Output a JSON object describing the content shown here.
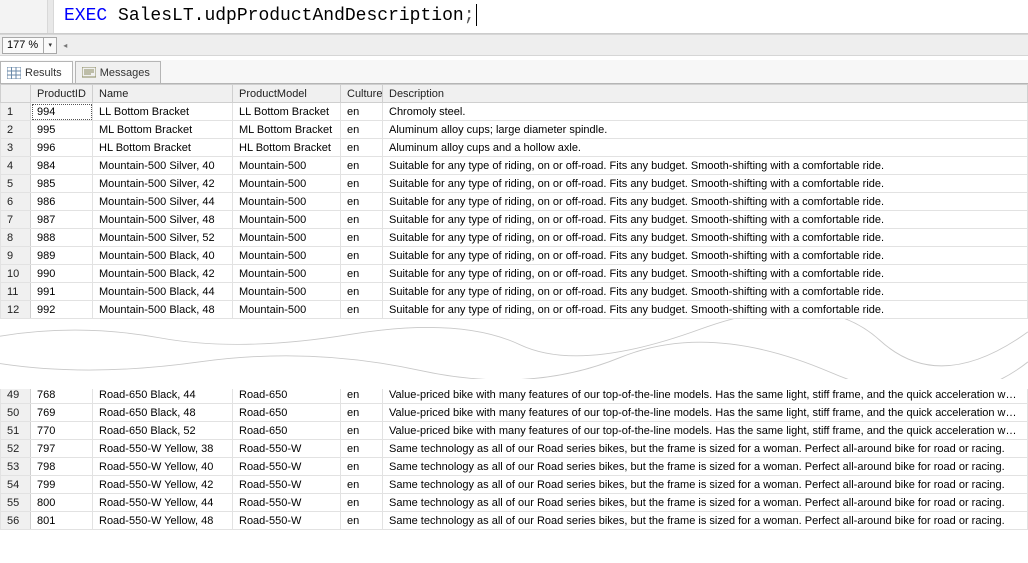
{
  "editor": {
    "keyword": "EXEC",
    "ident": "SalesLT.udpProductAndDescription",
    "punct": ";"
  },
  "zoom": {
    "value": "177 %"
  },
  "tabs": {
    "results": "Results",
    "messages": "Messages"
  },
  "columns": {
    "row": "",
    "productid": "ProductID",
    "name": "Name",
    "model": "ProductModel",
    "culture": "Culture",
    "desc": "Description"
  },
  "desc_strings": {
    "chromoly": "Chromoly steel.",
    "alloy_spindle": "Aluminum alloy cups; large diameter spindle.",
    "alloy_hollow": "Aluminum alloy cups and a hollow axle.",
    "mountain500": "Suitable for any type of riding, on or off-road. Fits any budget. Smooth-shifting with a comfortable ride.",
    "road650": "Value-priced bike with many features of our top-of-the-line models. Has the same light, stiff frame, and the quick acceleration we're famous for.",
    "road550w": "Same technology as all of our Road series bikes, but the frame is sized for a woman.  Perfect all-around bike for road or racing."
  },
  "rows_top": [
    {
      "n": "1",
      "pid": "994",
      "name": "LL Bottom Bracket",
      "model": "LL Bottom Bracket",
      "culture": "en",
      "dref": "chromoly"
    },
    {
      "n": "2",
      "pid": "995",
      "name": "ML Bottom Bracket",
      "model": "ML Bottom Bracket",
      "culture": "en",
      "dref": "alloy_spindle"
    },
    {
      "n": "3",
      "pid": "996",
      "name": "HL Bottom Bracket",
      "model": "HL Bottom Bracket",
      "culture": "en",
      "dref": "alloy_hollow"
    },
    {
      "n": "4",
      "pid": "984",
      "name": "Mountain-500 Silver, 40",
      "model": "Mountain-500",
      "culture": "en",
      "dref": "mountain500"
    },
    {
      "n": "5",
      "pid": "985",
      "name": "Mountain-500 Silver, 42",
      "model": "Mountain-500",
      "culture": "en",
      "dref": "mountain500"
    },
    {
      "n": "6",
      "pid": "986",
      "name": "Mountain-500 Silver, 44",
      "model": "Mountain-500",
      "culture": "en",
      "dref": "mountain500"
    },
    {
      "n": "7",
      "pid": "987",
      "name": "Mountain-500 Silver, 48",
      "model": "Mountain-500",
      "culture": "en",
      "dref": "mountain500"
    },
    {
      "n": "8",
      "pid": "988",
      "name": "Mountain-500 Silver, 52",
      "model": "Mountain-500",
      "culture": "en",
      "dref": "mountain500"
    },
    {
      "n": "9",
      "pid": "989",
      "name": "Mountain-500 Black, 40",
      "model": "Mountain-500",
      "culture": "en",
      "dref": "mountain500"
    },
    {
      "n": "10",
      "pid": "990",
      "name": "Mountain-500 Black, 42",
      "model": "Mountain-500",
      "culture": "en",
      "dref": "mountain500"
    },
    {
      "n": "11",
      "pid": "991",
      "name": "Mountain-500 Black, 44",
      "model": "Mountain-500",
      "culture": "en",
      "dref": "mountain500"
    },
    {
      "n": "12",
      "pid": "992",
      "name": "Mountain-500 Black, 48",
      "model": "Mountain-500",
      "culture": "en",
      "dref": "mountain500"
    }
  ],
  "rows_bottom": [
    {
      "n": "49",
      "pid": "768",
      "name": "Road-650 Black, 44",
      "model": "Road-650",
      "culture": "en",
      "dref": "road650"
    },
    {
      "n": "50",
      "pid": "769",
      "name": "Road-650 Black, 48",
      "model": "Road-650",
      "culture": "en",
      "dref": "road650"
    },
    {
      "n": "51",
      "pid": "770",
      "name": "Road-650 Black, 52",
      "model": "Road-650",
      "culture": "en",
      "dref": "road650"
    },
    {
      "n": "52",
      "pid": "797",
      "name": "Road-550-W Yellow, 38",
      "model": "Road-550-W",
      "culture": "en",
      "dref": "road550w"
    },
    {
      "n": "53",
      "pid": "798",
      "name": "Road-550-W Yellow, 40",
      "model": "Road-550-W",
      "culture": "en",
      "dref": "road550w"
    },
    {
      "n": "54",
      "pid": "799",
      "name": "Road-550-W Yellow, 42",
      "model": "Road-550-W",
      "culture": "en",
      "dref": "road550w"
    },
    {
      "n": "55",
      "pid": "800",
      "name": "Road-550-W Yellow, 44",
      "model": "Road-550-W",
      "culture": "en",
      "dref": "road550w"
    },
    {
      "n": "56",
      "pid": "801",
      "name": "Road-550-W Yellow, 48",
      "model": "Road-550-W",
      "culture": "en",
      "dref": "road550w"
    }
  ]
}
